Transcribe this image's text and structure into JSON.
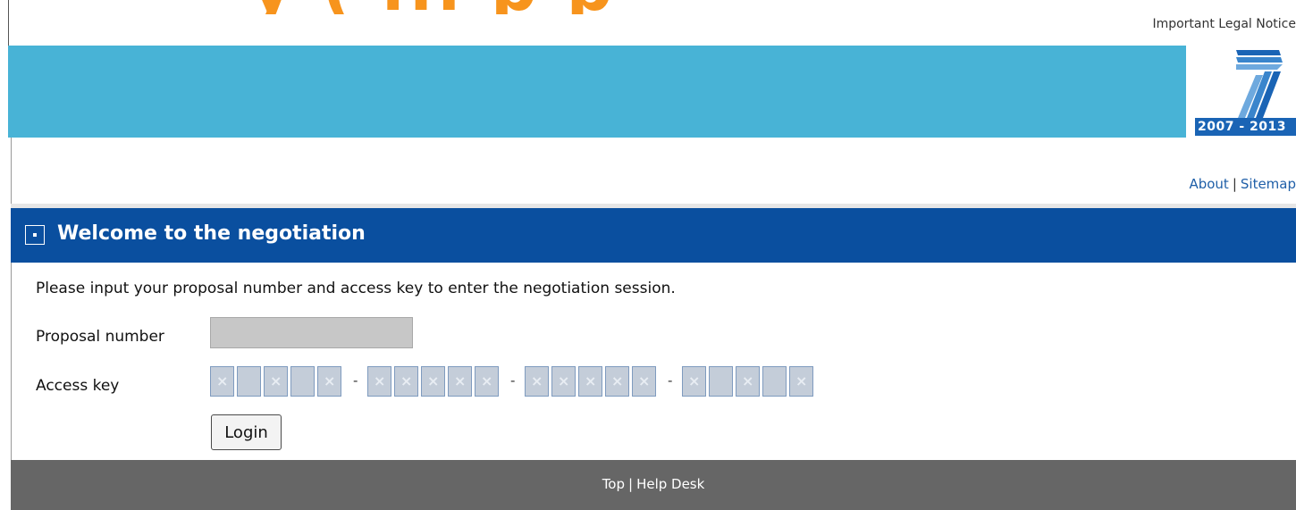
{
  "header": {
    "title_fragment": "y ( ... p p",
    "legal_notice": "Important Legal Notice",
    "logo": {
      "years": "2007 - 2013"
    },
    "links": {
      "about": "About",
      "sitemap": "Sitemap",
      "separator": "|"
    }
  },
  "panel": {
    "title": "Welcome to the negotiation"
  },
  "form": {
    "instruction": "Please input your proposal number and access key to enter the negotiation session.",
    "proposal_label": "Proposal number",
    "proposal_value": "",
    "access_label": "Access key",
    "key_separator": "-",
    "login_label": "Login"
  },
  "footer": {
    "top": "Top",
    "help_desk": "Help Desk",
    "separator": "|"
  },
  "colors": {
    "banner": "#48b3d6",
    "title_bar": "#0a4f9f",
    "footer": "#666666",
    "header_accent": "#f7941d"
  }
}
